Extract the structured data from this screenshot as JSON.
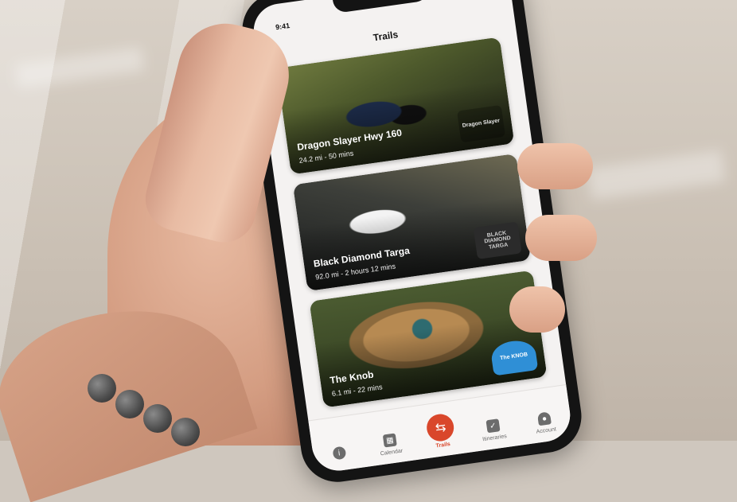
{
  "status_bar": {
    "time": "9:41"
  },
  "header": {
    "title": "Trails"
  },
  "trails": [
    {
      "name": "Dragon Slayer Hwy 160",
      "meta": "24.2 mi - 50 mins",
      "logo_icon": "dragon-logo-icon",
      "logo_text": "Dragon Slayer"
    },
    {
      "name": "Black Diamond Targa",
      "meta": "92.0 mi - 2 hours 12 mins",
      "logo_icon": "black-diamond-logo-icon",
      "logo_text": "BLACK DIAMOND TARGA"
    },
    {
      "name": "The Knob",
      "meta": "6.1 mi - 22 mins",
      "logo_icon": "knob-logo-icon",
      "logo_text": "The KNOB"
    }
  ],
  "tabbar": {
    "items": [
      {
        "label": "",
        "icon": "info-icon"
      },
      {
        "label": "Calendar",
        "icon": "calendar-icon"
      },
      {
        "label": "Trails",
        "icon": "trails-signpost-icon",
        "active": true
      },
      {
        "label": "Itineraries",
        "icon": "clipboard-icon"
      },
      {
        "label": "Account",
        "icon": "person-icon"
      }
    ]
  },
  "colors": {
    "accent": "#d9472b",
    "screen_bg": "#f4f2f1",
    "phone_frame": "#141414"
  }
}
